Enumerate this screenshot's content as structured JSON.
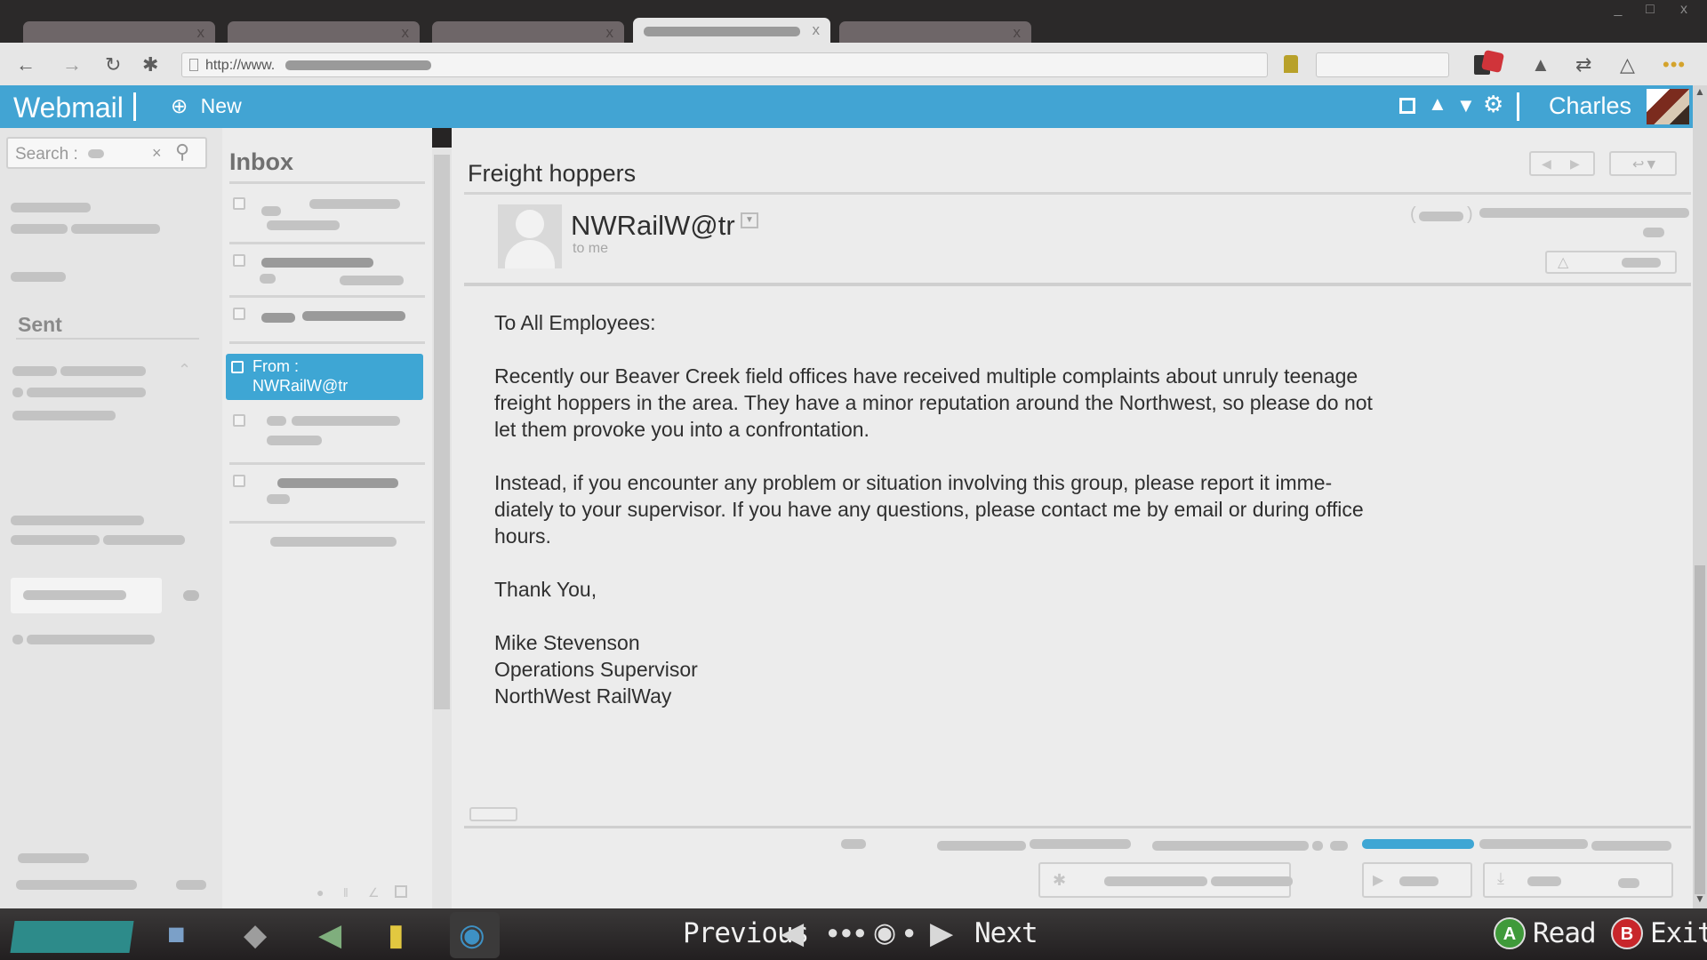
{
  "browser": {
    "url_prefix": "http://www.",
    "window_controls": {
      "minimize": "_",
      "maximize": "□",
      "close": "x"
    },
    "tab_close": "x"
  },
  "app": {
    "title": "Webmail",
    "new_label": "New",
    "user_name": "Charles"
  },
  "sidebar": {
    "search_label": "Search :",
    "sent_label": "Sent"
  },
  "inbox": {
    "title": "Inbox",
    "selected_item": {
      "from_label": "From :",
      "sender": "NWRailW@tr"
    }
  },
  "email": {
    "subject": "Freight hoppers",
    "sender": "NWRailW@tr",
    "recipient": "to me",
    "body": [
      "To All Employees:",
      "Recently our Beaver Creek field offices have received multiple complaints about unruly teenage freight hoppers in the area. They have a minor reputation around the Northwest, so please do not let them provoke you into a confrontation.",
      "Instead, if you encounter any problem or situation involving this group, please report it imme-diately to your supervisor. If you have any questions, please contact me by email or during office hours.",
      "Thank You,"
    ],
    "signature": [
      "Mike Stevenson",
      "Operations Supervisor",
      "NorthWest RailWay"
    ]
  },
  "game_bar": {
    "previous_label": "Previous",
    "next_label": "Next",
    "read_button": "A",
    "read_label": "Read",
    "exit_button": "B",
    "exit_label": "Exit"
  },
  "colors": {
    "accent": "#42a4d3",
    "read_button": "#3f9a3a",
    "exit_button": "#c8262b"
  }
}
